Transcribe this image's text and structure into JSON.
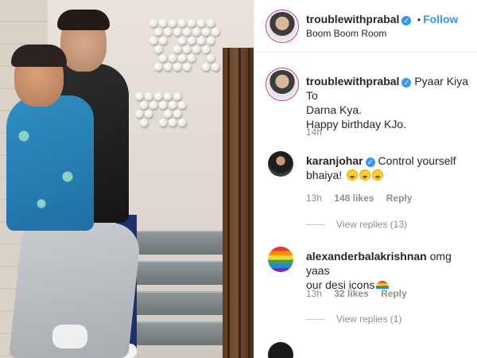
{
  "post": {
    "username": "troublewithprabal",
    "follow_label": "Follow",
    "location": "Boom Boom Room",
    "separator": "•"
  },
  "caption": {
    "username": "troublewithprabal",
    "line1": "Pyaar Kiya To",
    "line2": "Darna Kya.",
    "line3": "Happy birthday KJo.",
    "time": "14h"
  },
  "comments": [
    {
      "username": "karanjohar",
      "verified": true,
      "text_start": "Control yourself",
      "text_line2": "bhaiya!",
      "emojis": [
        "laughing-crying",
        "laughing-crying",
        "laughing-crying"
      ],
      "time": "13h",
      "likes": "148 likes",
      "reply_label": "Reply",
      "view_replies": "View replies (13)"
    },
    {
      "username": "alexanderbalakrishnan",
      "verified": false,
      "text_start": "omg yaas",
      "text_line2": "our desi icons",
      "emojis": [
        "rainbow"
      ],
      "time": "13h",
      "likes": "32 likes",
      "reply_label": "Reply",
      "view_replies": "View replies (1)"
    }
  ],
  "colors": {
    "link_blue": "#3897f0",
    "muted_gray": "#8e8e8e",
    "text_dark": "#262626"
  }
}
